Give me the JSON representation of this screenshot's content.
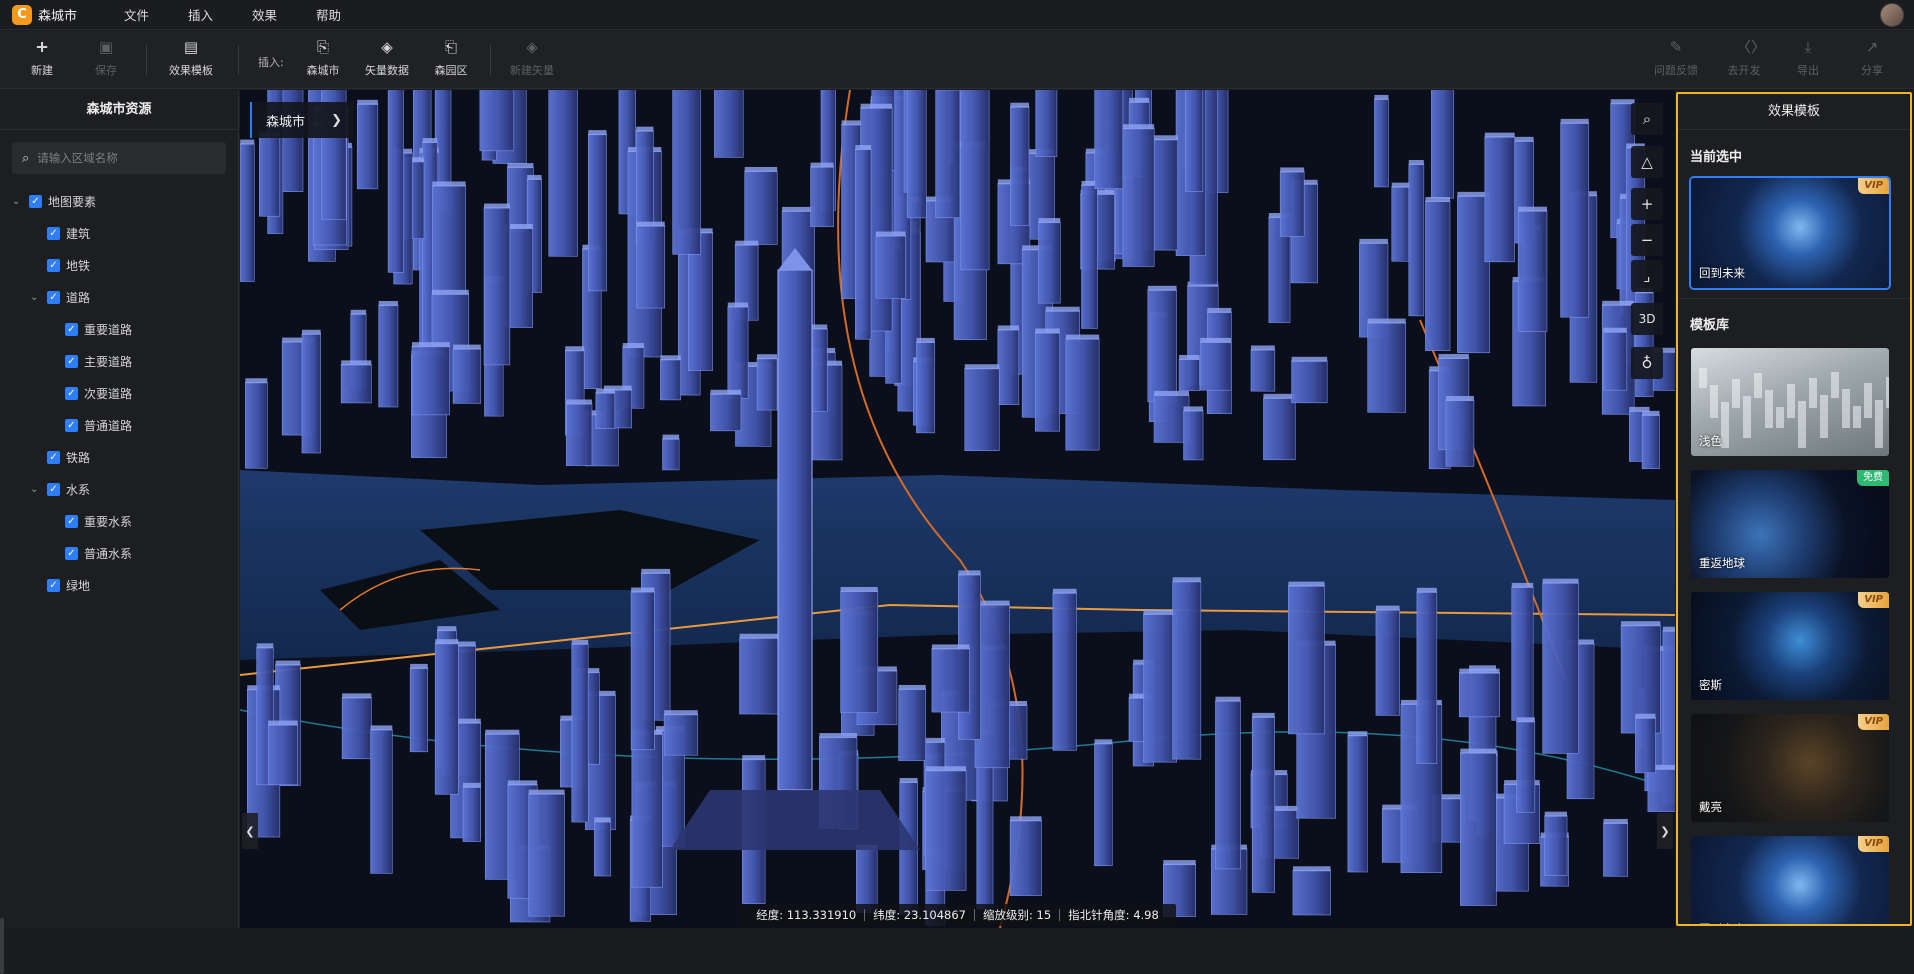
{
  "app": {
    "logo_letter": "C",
    "title": "森城市",
    "avatar_icon": "user-avatar-icon"
  },
  "menu": [
    "文件",
    "插入",
    "效果",
    "帮助"
  ],
  "toolbar": {
    "new_label": "新建",
    "save_label": "保存",
    "template_label": "效果模板",
    "insert_label": "插入:",
    "forest_city_label": "森城市",
    "vector_data_label": "矢量数据",
    "forest_park_label": "森园区",
    "new_vector_label": "新建矢量",
    "feedback_label": "问题反馈",
    "develop_label": "去开发",
    "export_label": "导出",
    "share_label": "分享"
  },
  "left_panel": {
    "title": "森城市资源",
    "search_placeholder": "请输入区域名称",
    "tree": [
      {
        "label": "地图要素",
        "level": 0,
        "expandable": true
      },
      {
        "label": "建筑",
        "level": 1,
        "expandable": false
      },
      {
        "label": "地铁",
        "level": 1,
        "expandable": false
      },
      {
        "label": "道路",
        "level": 1,
        "expandable": true
      },
      {
        "label": "重要道路",
        "level": 2,
        "expandable": false
      },
      {
        "label": "主要道路",
        "level": 2,
        "expandable": false
      },
      {
        "label": "次要道路",
        "level": 2,
        "expandable": false
      },
      {
        "label": "普通道路",
        "level": 2,
        "expandable": false
      },
      {
        "label": "铁路",
        "level": 1,
        "expandable": false
      },
      {
        "label": "水系",
        "level": 1,
        "expandable": true
      },
      {
        "label": "重要水系",
        "level": 2,
        "expandable": false
      },
      {
        "label": "普通水系",
        "level": 2,
        "expandable": false
      },
      {
        "label": "绿地",
        "level": 1,
        "expandable": false
      }
    ]
  },
  "map": {
    "breadcrumb": "森城市",
    "view_mode_label": "3D",
    "status": {
      "lon_label": "经度:",
      "lon_value": "113.331910",
      "lat_label": "纬度:",
      "lat_value": "23.104867",
      "zoom_label": "缩放级别:",
      "zoom_value": "15",
      "heading_label": "指北针角度:",
      "heading_value": "4.98"
    }
  },
  "right_panel": {
    "title": "效果模板",
    "current_label": "当前选中",
    "library_label": "模板库",
    "current": {
      "name": "回到未来",
      "badge": "VIP",
      "style": "globe-blue"
    },
    "templates": [
      {
        "name": "浅色",
        "badge": "",
        "style": "city-light"
      },
      {
        "name": "重返地球",
        "badge": "免费",
        "style": "earth"
      },
      {
        "name": "密斯",
        "badge": "VIP",
        "style": "globe-ring"
      },
      {
        "name": "戴亮",
        "badge": "VIP",
        "style": "globe-gold"
      },
      {
        "name": "回到未来",
        "badge": "VIP",
        "style": "globe-blue"
      }
    ]
  },
  "colors": {
    "accent": "#2f7ef5",
    "highlight": "#f0b429",
    "vip_gold": "#e6a33e",
    "free_green": "#2eb872"
  }
}
